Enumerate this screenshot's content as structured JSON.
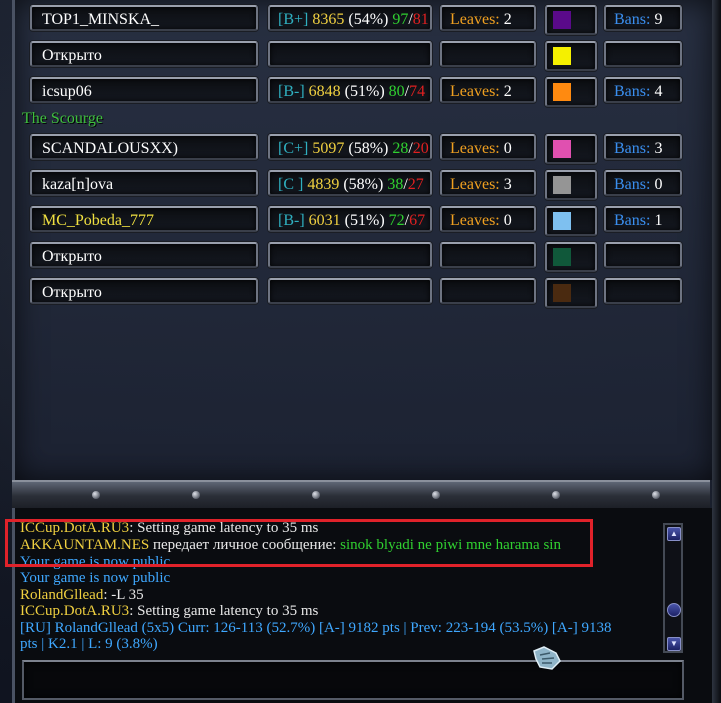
{
  "team_label": "The Scourge",
  "slots": [
    {
      "name": "TOP1_MINSKA_",
      "name_color": "#ffffff",
      "rank": "[B+]",
      "pts": "8365",
      "pct": "(54%)",
      "wins": "97",
      "losses": "81",
      "leaves_label": "Leaves:",
      "leaves": "2",
      "color": "#5a0a8a",
      "bans_label": "Bans:",
      "bans": "9"
    },
    {
      "name": "Открыто",
      "name_color": "#ffffff",
      "rank": "",
      "pts": "",
      "pct": "",
      "wins": "",
      "losses": "",
      "leaves_label": "",
      "leaves": "",
      "color": "#f5f000",
      "bans_label": "",
      "bans": ""
    },
    {
      "name": "icsup06",
      "name_color": "#ffffff",
      "rank": "[B-]",
      "pts": "6848",
      "pct": "(51%)",
      "wins": "80",
      "losses": "74",
      "leaves_label": "Leaves:",
      "leaves": "2",
      "color": "#ff8a10",
      "bans_label": "Bans:",
      "bans": "4"
    },
    {
      "name": "SCANDALOUSXX)",
      "name_color": "#ffffff",
      "rank": "[C+]",
      "pts": "5097",
      "pct": "(58%)",
      "wins": "28",
      "losses": "20",
      "leaves_label": "Leaves:",
      "leaves": "0",
      "color": "#e050b0",
      "bans_label": "Bans:",
      "bans": "3"
    },
    {
      "name": "kaza[n]ova",
      "name_color": "#ffffff",
      "rank": "[C ]",
      "pts": "4839",
      "pct": "(58%)",
      "wins": "38",
      "losses": "27",
      "leaves_label": "Leaves:",
      "leaves": "3",
      "color": "#959595",
      "bans_label": "Bans:",
      "bans": "0"
    },
    {
      "name": "MC_Pobeda_777",
      "name_color": "#f0e040",
      "rank": "[B-]",
      "pts": "6031",
      "pct": "(51%)",
      "wins": "72",
      "losses": "67",
      "leaves_label": "Leaves:",
      "leaves": "0",
      "color": "#7ec0f0",
      "bans_label": "Bans:",
      "bans": "1"
    },
    {
      "name": "Открыто",
      "name_color": "#ffffff",
      "rank": "",
      "pts": "",
      "pct": "",
      "wins": "",
      "losses": "",
      "leaves_label": "",
      "leaves": "",
      "color": "#10583a",
      "bans_label": "",
      "bans": ""
    },
    {
      "name": "Открыто",
      "name_color": "#ffffff",
      "rank": "",
      "pts": "",
      "pct": "",
      "wins": "",
      "losses": "",
      "leaves_label": "",
      "leaves": "",
      "color": "#4a2a10",
      "bans_label": "",
      "bans": ""
    }
  ],
  "chat": [
    {
      "parts": [
        {
          "text": "ICCup.DotA.RU3",
          "cls": "sender-gold"
        },
        {
          "text": ": Setting game latency to 35 ms",
          "cls": ""
        }
      ]
    },
    {
      "parts": [
        {
          "text": "AKKAUNTAM.NES",
          "cls": "sender-gold"
        },
        {
          "text": " передает личное сообщение: ",
          "cls": ""
        },
        {
          "text": "sinok blyadi ne piwi mne harama sin",
          "cls": "green-msg"
        }
      ]
    },
    {
      "parts": [
        {
          "text": "Your game is now public",
          "cls": "sys-blue"
        }
      ]
    },
    {
      "parts": [
        {
          "text": "Your game is now public",
          "cls": "sys-blue"
        }
      ]
    },
    {
      "parts": [
        {
          "text": "RolandGllead",
          "cls": "sender-gold"
        },
        {
          "text": ": -L 35",
          "cls": ""
        }
      ]
    },
    {
      "parts": [
        {
          "text": "ICCup.DotA.RU3",
          "cls": "sender-gold"
        },
        {
          "text": ": Setting game latency to 35 ms",
          "cls": ""
        }
      ]
    },
    {
      "parts": [
        {
          "text": "[RU] RolandGllead (5x5) Curr: 126-113 (52.7%) [A-] 9182 pts | Prev: 223-194 (53.5%) [A-] 9138",
          "cls": "sys-blue"
        }
      ]
    },
    {
      "parts": [
        {
          "text": "pts | K2.1 | L: 9 (3.8%)",
          "cls": "sys-blue"
        }
      ]
    }
  ],
  "colors": {
    "highlight": "#e0222a",
    "team_label": "#3fbf3f"
  }
}
